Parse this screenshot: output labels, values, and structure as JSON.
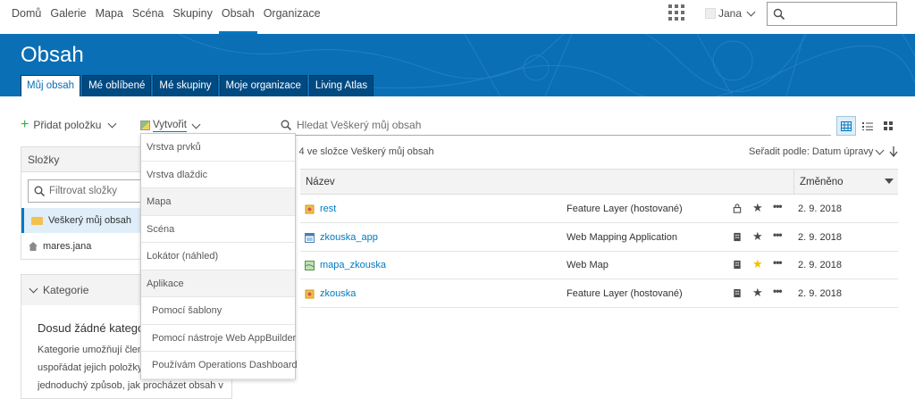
{
  "nav": {
    "items": [
      "Domů",
      "Galerie",
      "Mapa",
      "Scéna",
      "Skupiny",
      "Obsah",
      "Organizace"
    ],
    "active": "Obsah",
    "user": "Jana"
  },
  "header": {
    "title": "Obsah",
    "tabs": [
      "Můj obsah",
      "Mé oblíbené",
      "Mé skupiny",
      "Moje organizace",
      "Living Atlas"
    ]
  },
  "toolbar": {
    "add_label": "Přidat položku",
    "create_label": "Vytvořit",
    "search_placeholder": "Hledat Veškerý můj obsah",
    "count_text": "z 4 ve složce Veškerý můj obsah",
    "sort_text": "Seřadit podle: Datum úpravy"
  },
  "folders": {
    "title": "Složky",
    "filter_placeholder": "Filtrovat složky",
    "items": [
      "Veškerý můj obsah",
      "mares.jana"
    ]
  },
  "categories": {
    "title": "Kategorie",
    "empty_title": "Dosud žádné kategor",
    "desc": [
      "Kategorie umožňují člena",
      "uspořádat jejich položky",
      "jednoduchý způsob, jak procházet obsah v"
    ]
  },
  "table": {
    "col_name": "Název",
    "col_modified": "Změněno",
    "rows": [
      {
        "name": "rest",
        "type": "Feature Layer (hostované)",
        "date": "2. 9. 2018",
        "icon": "feature-layer-icon",
        "share": "lock-icon",
        "fav": false
      },
      {
        "name": "zkouska_app",
        "type": "Web Mapping Application",
        "date": "2. 9. 2018",
        "icon": "web-app-icon",
        "share": "organization-icon",
        "fav": false
      },
      {
        "name": "mapa_zkouska",
        "type": "Web Map",
        "date": "2. 9. 2018",
        "icon": "web-map-icon",
        "share": "organization-icon",
        "fav": true
      },
      {
        "name": "zkouska",
        "type": "Feature Layer (hostované)",
        "date": "2. 9. 2018",
        "icon": "feature-layer-icon",
        "share": "organization-icon",
        "fav": false
      }
    ]
  },
  "create_menu": [
    {
      "label": "Vrstva prvků",
      "kind": "item"
    },
    {
      "label": "Vrstva dlaždic",
      "kind": "item"
    },
    {
      "label": "Mapa",
      "kind": "group"
    },
    {
      "label": "Scéna",
      "kind": "item"
    },
    {
      "label": "Lokátor (náhled)",
      "kind": "item"
    },
    {
      "label": "Aplikace",
      "kind": "group"
    },
    {
      "label": "Pomocí šablony",
      "kind": "sub"
    },
    {
      "label": "Pomocí nástroje Web AppBuilder",
      "kind": "sub"
    },
    {
      "label": "Používám Operations Dashboard",
      "kind": "sub"
    }
  ],
  "colors": {
    "brand": "#0a6fb5",
    "link": "#0079c1",
    "star_fav": "#f2c000"
  }
}
